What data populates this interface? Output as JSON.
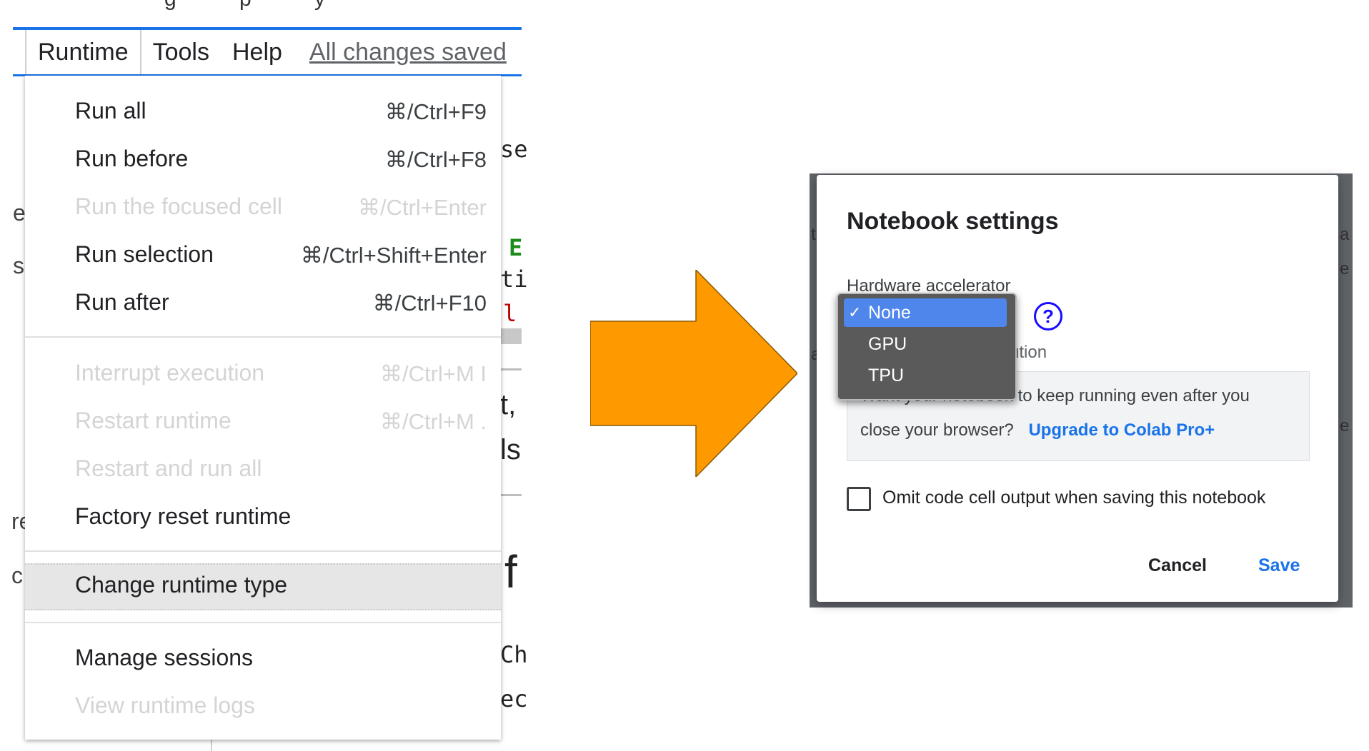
{
  "left_panel": {
    "menubar": {
      "items": [
        "Runtime",
        "Tools",
        "Help"
      ],
      "saved_status": "All changes saved"
    },
    "runtime_menu": {
      "groups": [
        [
          {
            "label": "Run all",
            "shortcut": "⌘/Ctrl+F9",
            "enabled": true
          },
          {
            "label": "Run before",
            "shortcut": "⌘/Ctrl+F8",
            "enabled": true
          },
          {
            "label": "Run the focused cell",
            "shortcut": "⌘/Ctrl+Enter",
            "enabled": false
          },
          {
            "label": "Run selection",
            "shortcut": "⌘/Ctrl+Shift+Enter",
            "enabled": true
          },
          {
            "label": "Run after",
            "shortcut": "⌘/Ctrl+F10",
            "enabled": true
          }
        ],
        [
          {
            "label": "Interrupt execution",
            "shortcut": "⌘/Ctrl+M I",
            "enabled": false
          },
          {
            "label": "Restart runtime",
            "shortcut": "⌘/Ctrl+M .",
            "enabled": false
          },
          {
            "label": "Restart and run all",
            "shortcut": "",
            "enabled": false
          },
          {
            "label": "Factory reset runtime",
            "shortcut": "",
            "enabled": true
          }
        ],
        [
          {
            "label": "Change runtime type",
            "shortcut": "",
            "enabled": true,
            "highlighted": true
          }
        ],
        [
          {
            "label": "Manage sessions",
            "shortcut": "",
            "enabled": true
          },
          {
            "label": "View runtime logs",
            "shortcut": "",
            "enabled": false
          }
        ]
      ]
    },
    "background_fragments": [
      "se",
      "E",
      "ti",
      "l",
      "t,",
      "ls",
      "f",
      "Ch",
      "ec",
      "e",
      "s",
      "re",
      "c"
    ]
  },
  "arrow": {
    "color": "#FF9900",
    "icon": "right-arrow"
  },
  "right_panel": {
    "dialog": {
      "title": "Notebook settings",
      "hardware_label": "Hardware accelerator",
      "options": [
        "None",
        "GPU",
        "TPU"
      ],
      "selected": "None",
      "check_mark": "✓",
      "help_symbol": "?",
      "hint_fragment": "cution",
      "promo_text_line1": "Want your notebook to keep running even after you",
      "promo_text_line2": "close your browser?",
      "promo_link": "Upgrade to Colab Pro+",
      "omit_output_label": "Omit code cell output when saving this notebook",
      "omit_output_checked": false,
      "cancel_label": "Cancel",
      "save_label": "Save"
    }
  },
  "colors": {
    "accent": "#1a73e8",
    "arrow": "#FF9900",
    "selection": "#4f86ec"
  }
}
